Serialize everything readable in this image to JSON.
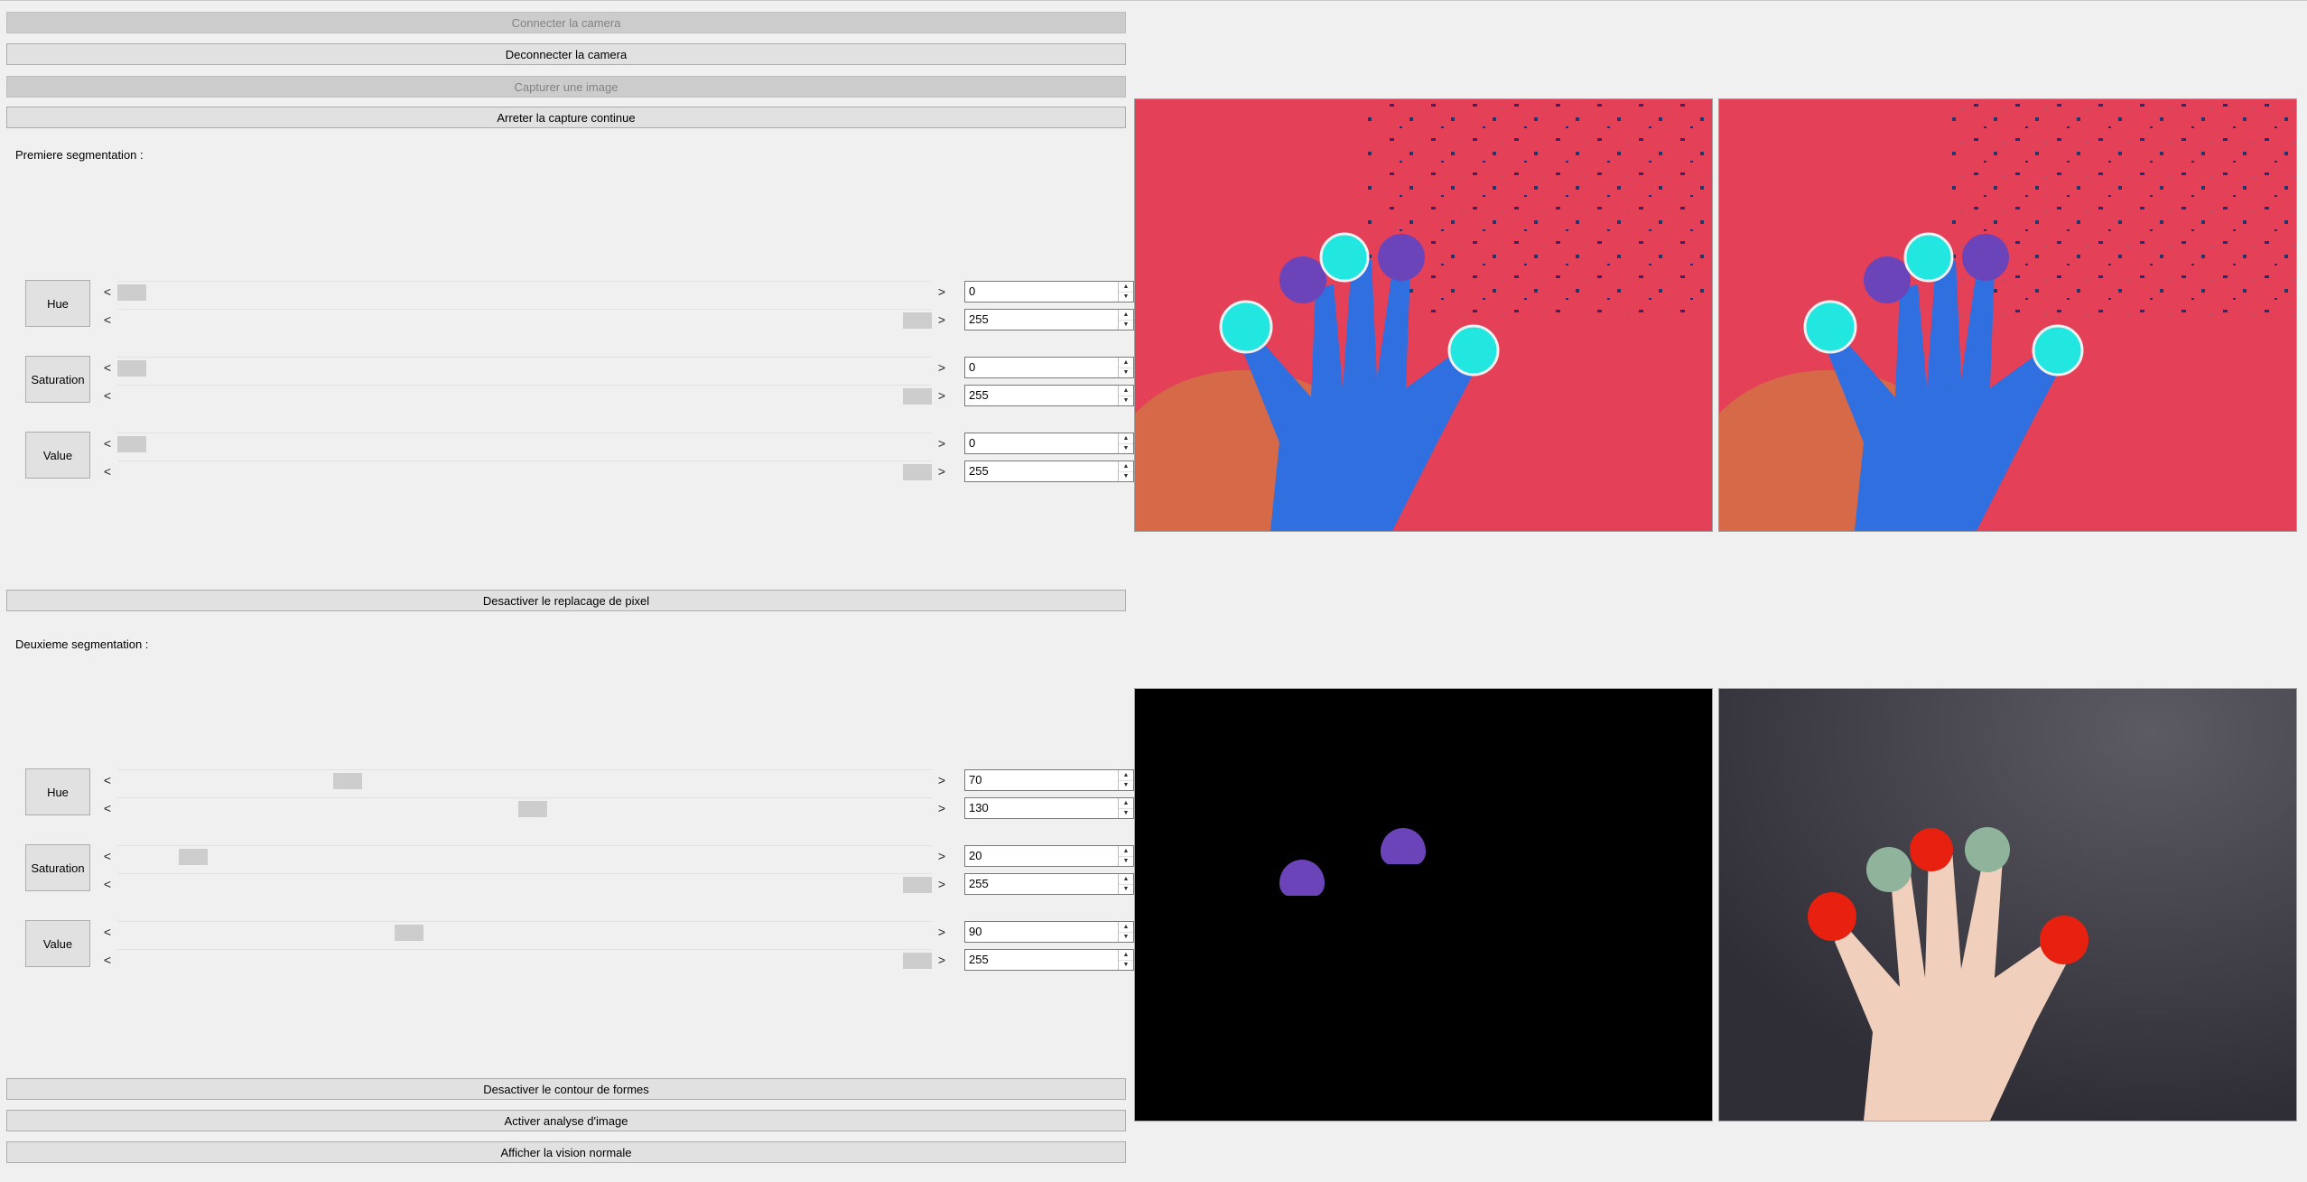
{
  "buttons": {
    "connect": "Connecter la camera",
    "disconnect": "Deconnecter la camera",
    "capture": "Capturer une image",
    "stop_continuous": "Arreter la capture continue",
    "pixel_replace": "Desactiver le replacage de pixel",
    "contour": "Desactiver le contour de formes",
    "analysis": "Activer analyse d'image",
    "normal_vision": "Afficher la vision normale"
  },
  "segmentation1": {
    "title": "Premiere segmentation :",
    "hue": {
      "label": "Hue",
      "min": "0",
      "max": "255"
    },
    "saturation": {
      "label": "Saturation",
      "min": "0",
      "max": "255"
    },
    "value": {
      "label": "Value",
      "min": "0",
      "max": "255"
    }
  },
  "segmentation2": {
    "title": "Deuxieme segmentation :",
    "hue": {
      "label": "Hue",
      "min": "70",
      "max": "130"
    },
    "saturation": {
      "label": "Saturation",
      "min": "20",
      "max": "255"
    },
    "value": {
      "label": "Value",
      "min": "90",
      "max": "255"
    }
  },
  "slider_range": {
    "min": 0,
    "max": 255
  },
  "arrows": {
    "left": "<",
    "right": ">",
    "up": "▲",
    "down": "▼"
  },
  "colors": {
    "hsv_background": "#e8424e",
    "hand_blue": "#2f6fe0",
    "marker_cyan": "#22e6e0",
    "marker_purple": "#6a44b8",
    "real_background": "#3b3a44",
    "real_red": "#e8200f",
    "real_green": "#8fb49b"
  }
}
